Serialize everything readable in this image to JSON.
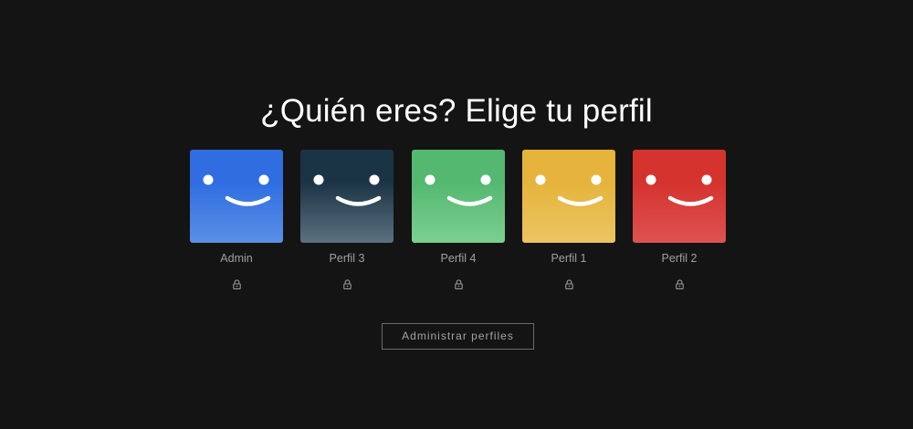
{
  "header": {
    "title": "¿Quién eres? Elige tu perfil"
  },
  "profiles": [
    {
      "name": "Admin",
      "color_top": "#2f6de1",
      "color_bottom": "#5b8fe6",
      "locked": true
    },
    {
      "name": "Perfil 3",
      "color_top": "#1b3445",
      "color_bottom": "#5b7180",
      "locked": true
    },
    {
      "name": "Perfil 4",
      "color_top": "#54b871",
      "color_bottom": "#7cd08f",
      "locked": true
    },
    {
      "name": "Perfil 1",
      "color_top": "#e6b43c",
      "color_bottom": "#ebc462",
      "locked": true
    },
    {
      "name": "Perfil 2",
      "color_top": "#d5332d",
      "color_bottom": "#dd5252",
      "locked": true
    }
  ],
  "manage_button": {
    "label": "Administrar perfiles"
  },
  "icons": {
    "avatar": "smiley-face-icon",
    "lock": "lock-icon"
  }
}
